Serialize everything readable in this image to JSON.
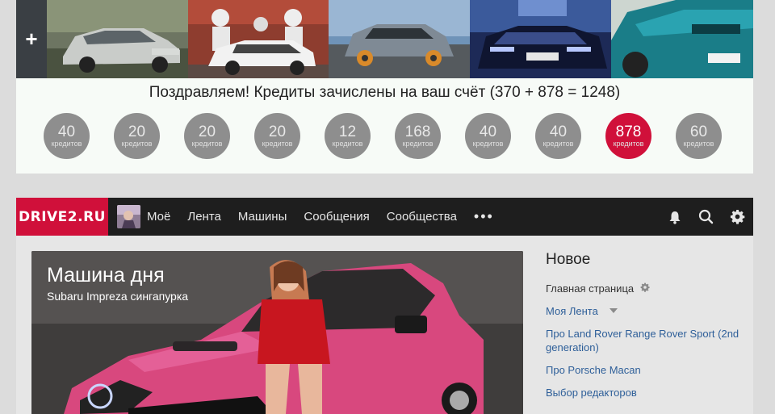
{
  "credits": {
    "add_label": "+",
    "message": "Поздравляем! Кредиты зачислены на ваш счёт (370 + 878 = 1248)",
    "unit": "кредитов",
    "badges": [
      {
        "amount": "40",
        "highlight": false
      },
      {
        "amount": "20",
        "highlight": false
      },
      {
        "amount": "20",
        "highlight": false
      },
      {
        "amount": "20",
        "highlight": false
      },
      {
        "amount": "12",
        "highlight": false
      },
      {
        "amount": "168",
        "highlight": false
      },
      {
        "amount": "40",
        "highlight": false
      },
      {
        "amount": "40",
        "highlight": false
      },
      {
        "amount": "878",
        "highlight": true
      },
      {
        "amount": "60",
        "highlight": false
      }
    ]
  },
  "header": {
    "logo": "DRIVE2.RU",
    "nav": [
      "Моё",
      "Лента",
      "Машины",
      "Сообщения",
      "Сообщества"
    ],
    "more": "•••",
    "icons": [
      "bell-icon",
      "search-icon",
      "gear-icon"
    ]
  },
  "hero": {
    "title": "Машина дня",
    "subtitle": "Subaru Impreza сингапурка"
  },
  "sidebar": {
    "title": "Новое",
    "items": [
      {
        "label": "Главная страница"
      },
      {
        "label": "Моя Лента"
      },
      {
        "label": "Про Land Rover Range Rover Sport (2nd generation)"
      },
      {
        "label": "Про Porsche Macan"
      },
      {
        "label": "Выбор редакторов"
      }
    ]
  },
  "colors": {
    "brand_red": "#d0103a",
    "header_bg": "#1e1e1e",
    "link_blue": "#2e5f99",
    "badge_gray": "#8e8e8e"
  }
}
